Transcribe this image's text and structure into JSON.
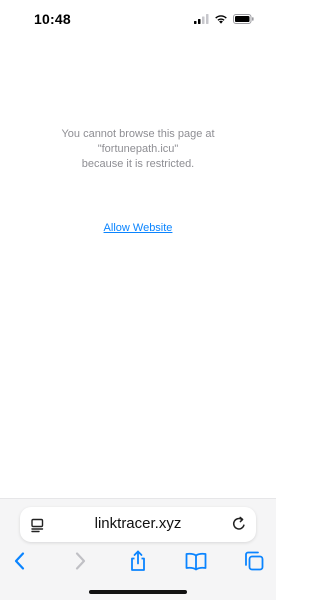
{
  "status_bar": {
    "time": "10:48",
    "icons": [
      "cellular-signal-icon",
      "wifi-icon",
      "battery-icon"
    ]
  },
  "page": {
    "message_lines": [
      "You cannot browse this page at",
      "\"fortunepath.icu\"",
      "because it is restricted."
    ],
    "allow_link": "Allow Website"
  },
  "address_bar": {
    "url": "linktracer.xyz",
    "left_icon": "reader-icon",
    "right_icon": "reload-icon"
  },
  "toolbar": {
    "buttons": [
      "back-icon",
      "forward-icon",
      "share-icon",
      "bookmarks-icon",
      "tabs-icon"
    ]
  },
  "colors": {
    "accent": "#0a84ff",
    "message_text": "#8e8e93",
    "toolbar_bg": "#f5f5f6"
  }
}
